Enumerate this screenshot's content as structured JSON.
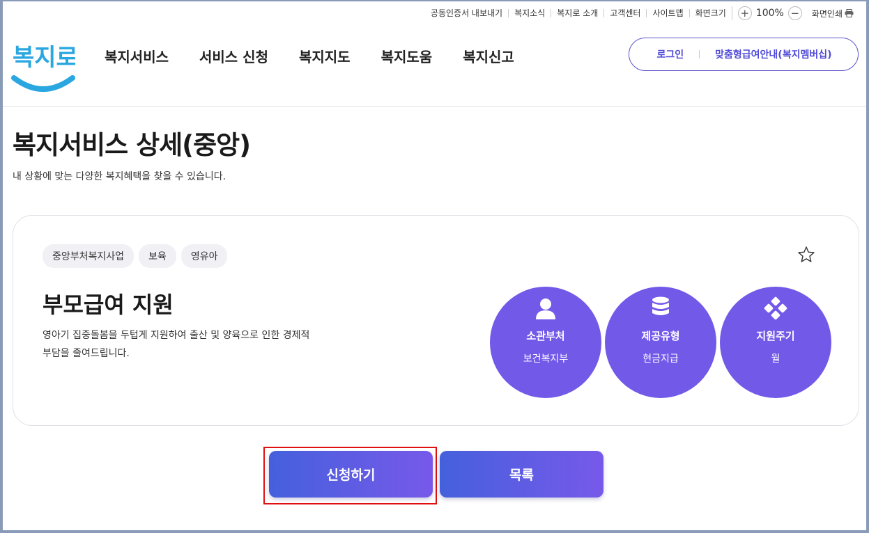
{
  "utility": {
    "links": [
      "공동인증서 내보내기",
      "복지소식",
      "복지로 소개",
      "고객센터",
      "사이트맵",
      "화면크기"
    ],
    "zoom_in": "+",
    "zoom_value": "100%",
    "zoom_out": "−",
    "print_label": "화면인쇄"
  },
  "header": {
    "logo_text": "복지로",
    "nav": [
      "복지서비스",
      "서비스 신청",
      "복지지도",
      "복지도움",
      "복지신고"
    ],
    "login": "로그인",
    "membership": "맞춤형급여안내(복지멤버십)"
  },
  "page": {
    "title": "복지서비스 상세(중앙)",
    "subtitle": "내 상황에 맞는 다양한 복지혜택을 찾을 수 있습니다."
  },
  "service": {
    "tags": [
      "중앙부처복지사업",
      "보육",
      "영유아"
    ],
    "title": "부모급여 지원",
    "description": "영아기 집중돌봄을 두텁게 지원하여 출산 및 양육으로 인한 경제적 부담을 줄여드립니다.",
    "info": [
      {
        "icon": "person-icon",
        "label": "소관부처",
        "value": "보건복지부"
      },
      {
        "icon": "database-icon",
        "label": "제공유형",
        "value": "현금지급"
      },
      {
        "icon": "cycle-icon",
        "label": "지원주기",
        "value": "월"
      }
    ]
  },
  "actions": {
    "apply": "신청하기",
    "list": "목록"
  },
  "colors": {
    "accent": "#7259e8",
    "button_start": "#4560dc",
    "button_end": "#7759ea",
    "logo_blue": "#2aa7e0",
    "highlight": "#e01010"
  }
}
